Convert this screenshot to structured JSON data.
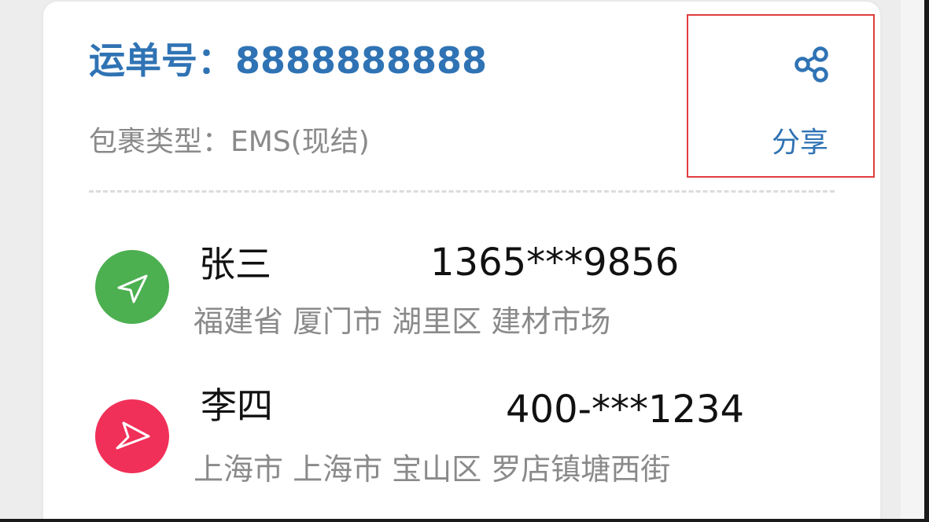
{
  "waybill": {
    "label": "运单号：",
    "number": "8888888888"
  },
  "package": {
    "type_text": "包裹类型：EMS(现结)"
  },
  "share": {
    "icon": "share-icon",
    "label": "分享",
    "highlight_color": "#e03c3c"
  },
  "sender": {
    "icon": "send-arrow-icon",
    "icon_color": "#4caf50",
    "name": "张三",
    "phone": "1365***9856",
    "address": "福建省 厦门市 湖里区 建材市场"
  },
  "receiver": {
    "icon": "receive-arrow-icon",
    "icon_color": "#f03058",
    "name": "李四",
    "phone": "400-***1234",
    "address": "上海市 上海市 宝山区 罗店镇塘西街"
  },
  "colors": {
    "accent": "#2f73b4",
    "secondary_text": "#8a8a8a",
    "primary_text": "#111111"
  }
}
